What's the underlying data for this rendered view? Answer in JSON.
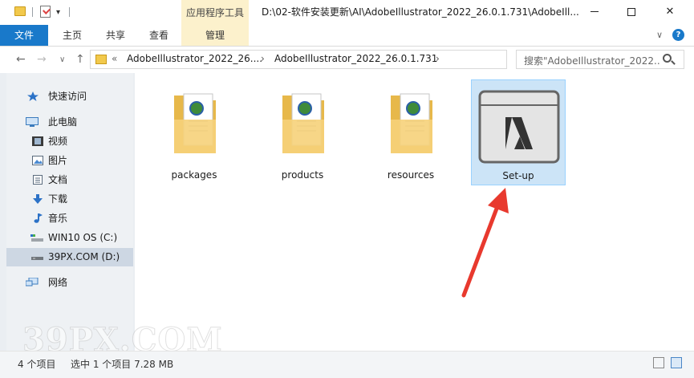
{
  "window": {
    "title": "D:\\02-软件安装更新\\AI\\AdobeIllustrator_2022_26.0.1.731\\AdobeIll...",
    "context_tab_header": "应用程序工具"
  },
  "ribbon": {
    "tabs": [
      {
        "label": "文件"
      },
      {
        "label": "主页"
      },
      {
        "label": "共享"
      },
      {
        "label": "查看"
      },
      {
        "label": "管理"
      }
    ]
  },
  "address": {
    "crumbs": [
      "«",
      "AdobeIllustrator_2022_26....",
      "›",
      "AdobeIllustrator_2022_26.0.1.731",
      "›"
    ],
    "search_placeholder": "搜索\"AdobeIllustrator_2022..."
  },
  "nav": {
    "items": [
      {
        "label": "快速访问",
        "icon": "star-icon"
      },
      {
        "label": "此电脑",
        "icon": "computer-icon"
      },
      {
        "label": "视频",
        "icon": "video-icon"
      },
      {
        "label": "图片",
        "icon": "picture-icon"
      },
      {
        "label": "文档",
        "icon": "document-icon"
      },
      {
        "label": "下载",
        "icon": "download-icon"
      },
      {
        "label": "音乐",
        "icon": "music-icon"
      },
      {
        "label": "WIN10 OS (C:)",
        "icon": "drive-icon"
      },
      {
        "label": "39PX.COM (D:)",
        "icon": "drive-icon"
      },
      {
        "label": "网络",
        "icon": "network-icon"
      }
    ]
  },
  "files": [
    {
      "name": "packages",
      "type": "folder"
    },
    {
      "name": "products",
      "type": "folder"
    },
    {
      "name": "resources",
      "type": "folder"
    },
    {
      "name": "Set-up",
      "type": "application"
    }
  ],
  "status": {
    "count": "4 个项目",
    "selection": "选中 1 个项目  7.28 MB"
  },
  "watermark": "39PX.COM",
  "colors": {
    "accent": "#1979ca",
    "context_tab": "#fcf1cc",
    "selection": "#cce4f7",
    "arrow": "#e8392e"
  }
}
